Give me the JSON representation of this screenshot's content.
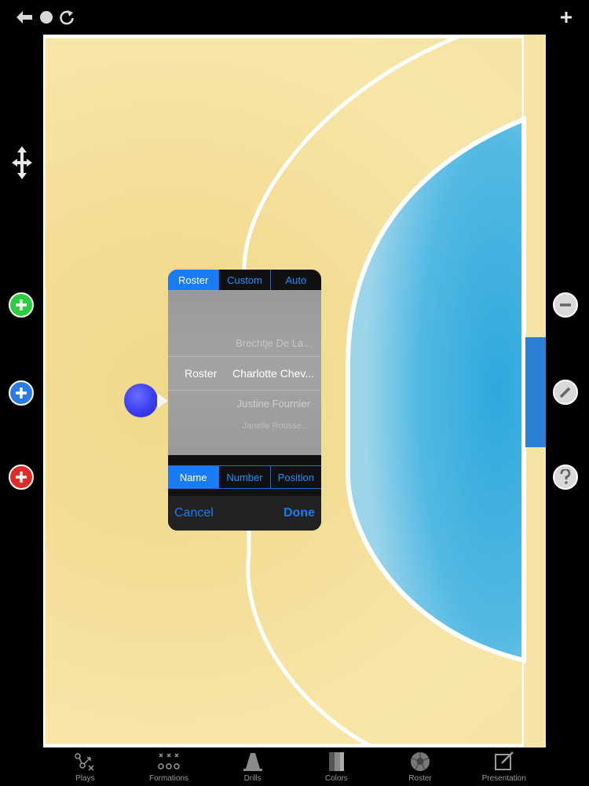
{
  "popup": {
    "tabs_top": [
      "Roster",
      "Custom",
      "Auto"
    ],
    "picker_label": "Roster",
    "players": {
      "above": "Brechtje De La...",
      "selected": "Charlotte Chev...",
      "below": "Justine Fournier",
      "below2": "Janelle Rousse..."
    },
    "tabs_bottom": [
      "Name",
      "Number",
      "Position"
    ],
    "cancel": "Cancel",
    "done": "Done"
  },
  "tabbar": {
    "items": [
      {
        "label": "Plays",
        "icon": "plays-icon"
      },
      {
        "label": "Formations",
        "icon": "formations-icon"
      },
      {
        "label": "Drills",
        "icon": "drills-icon"
      },
      {
        "label": "Colors",
        "icon": "colors-icon"
      },
      {
        "label": "Roster",
        "icon": "roster-icon"
      },
      {
        "label": "Presentation",
        "icon": "presentation-icon"
      }
    ]
  },
  "colors": {
    "accent": "#1a7cf5",
    "court": "#f3dd95",
    "goal_area": "#3aaee0",
    "player": "#3b3df0",
    "add_green": "#2ecc40",
    "add_blue": "#2a7be4",
    "add_red": "#e02b2b"
  }
}
